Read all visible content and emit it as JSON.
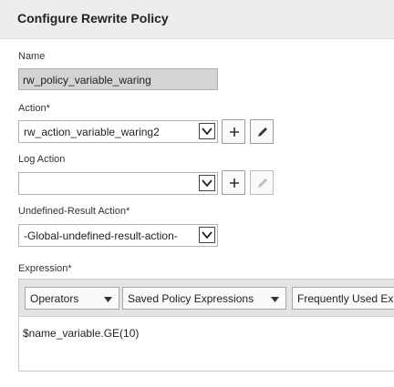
{
  "header": {
    "title": "Configure Rewrite Policy"
  },
  "name_field": {
    "label": "Name",
    "value": "rw_policy_variable_waring"
  },
  "action_field": {
    "label": "Action*",
    "value": "rw_action_variable_waring2"
  },
  "log_action_field": {
    "label": "Log Action",
    "value": ""
  },
  "undefined_result_field": {
    "label": "Undefined-Result Action*",
    "value": "-Global-undefined-result-action-"
  },
  "expression": {
    "label": "Expression*",
    "toolbar": {
      "operators": "Operators",
      "saved_policy_expressions": "Saved Policy Expressions",
      "frequently_used": "Frequently Used Exp"
    },
    "value": "$name_variable.GE(10)"
  },
  "icons": {
    "add": "plus-icon",
    "edit": "pencil-icon",
    "dropdown": "chevron-down-icon"
  }
}
